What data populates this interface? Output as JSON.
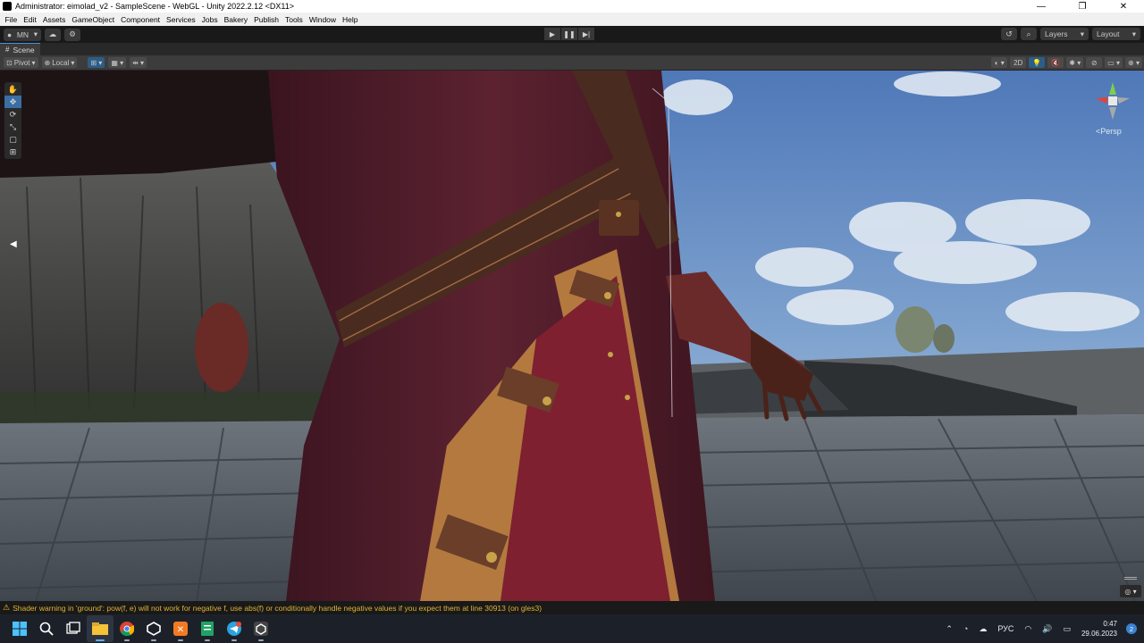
{
  "window": {
    "title": "Administrator: eimolad_v2 - SampleScene - WebGL - Unity 2022.2.12 <DX11>",
    "minimize_glyph": "—",
    "maximize_glyph": "❐",
    "close_glyph": "✕"
  },
  "menu": [
    "File",
    "Edit",
    "Assets",
    "GameObject",
    "Component",
    "Services",
    "Jobs",
    "Bakery",
    "Publish",
    "Tools",
    "Window",
    "Help"
  ],
  "toolbar": {
    "account_label": "MN",
    "layers_label": "Layers",
    "layout_label": "Layout"
  },
  "scene_tab": {
    "label": "Scene"
  },
  "scene_toolbar": {
    "pivot_label": "Pivot",
    "local_label": "Local",
    "mode_2d_label": "2D"
  },
  "viewport": {
    "persp_label": "Persp"
  },
  "status": {
    "message": "Shader warning in 'ground': pow(f, e) will not work for negative f, use abs(f) or conditionally handle negative values if you expect them at line 30913 (on gles3)"
  },
  "taskbar": {
    "language": "РУС",
    "time": "0:47",
    "date": "29.06.2023",
    "notification_count": "2"
  },
  "colors": {
    "accent": "#3a6ea5",
    "warning": "#e0b232",
    "editor_dark": "#191919"
  }
}
